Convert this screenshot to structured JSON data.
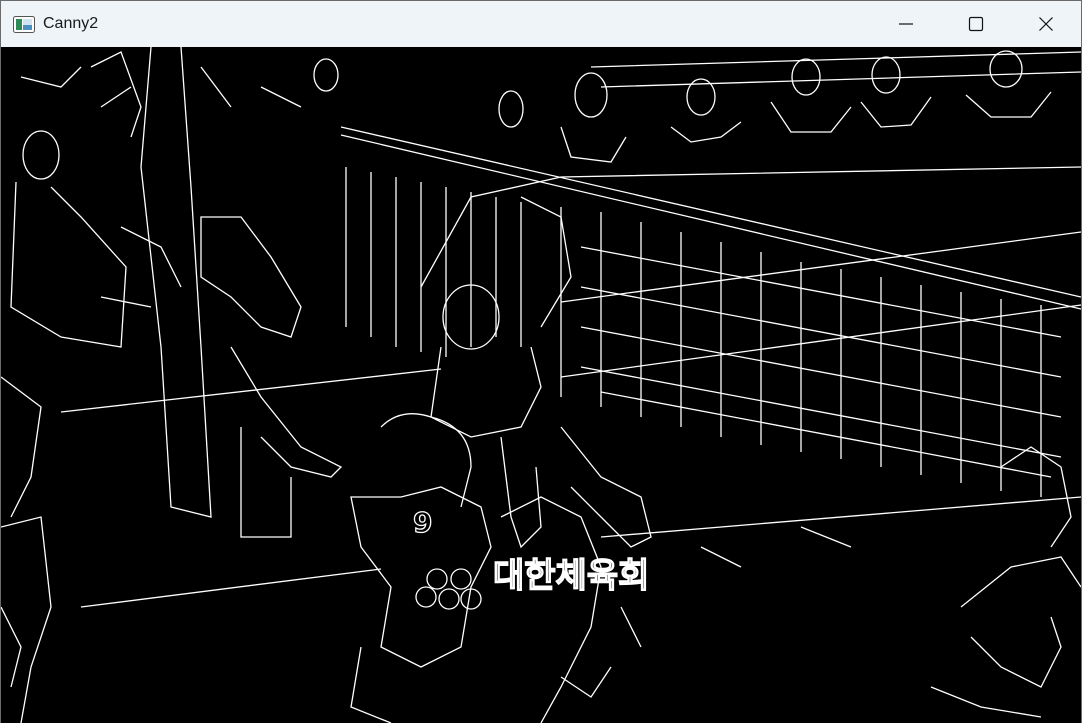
{
  "window": {
    "title": "Canny2",
    "icon": "window-app-icon",
    "controls": [
      "minimize-icon",
      "maximize-icon",
      "close-icon"
    ]
  },
  "image": {
    "kind": "canny-edge-detection-output",
    "background": "#000000",
    "edge_color": "#ffffff",
    "jersey_number": "9",
    "sign_text": "대한체육회"
  }
}
